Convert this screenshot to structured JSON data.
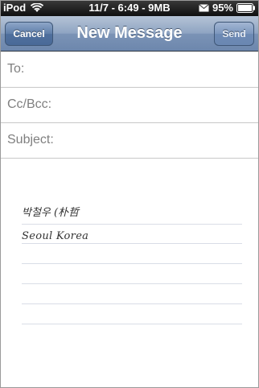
{
  "status_bar": {
    "carrier": "iPod",
    "center_text": "11/7 - 6:49 - 9MB",
    "battery_percent": "95%",
    "icons": [
      "wifi-icon",
      "mail-icon",
      "battery-icon"
    ]
  },
  "navbar": {
    "title": "New Message",
    "cancel_label": "Cancel",
    "send_label": "Send"
  },
  "fields": {
    "to_label": "To:",
    "cc_label": "Cc/Bcc:",
    "subject_label": "Subject:"
  },
  "body": {
    "handwriting_line1": "박철우 (朴哲",
    "handwriting_line2": "Seoul Korea"
  },
  "colors": {
    "navbar": "#7b93b6",
    "status_bar": "#1a1a1a",
    "rule": "#d9dde6"
  }
}
